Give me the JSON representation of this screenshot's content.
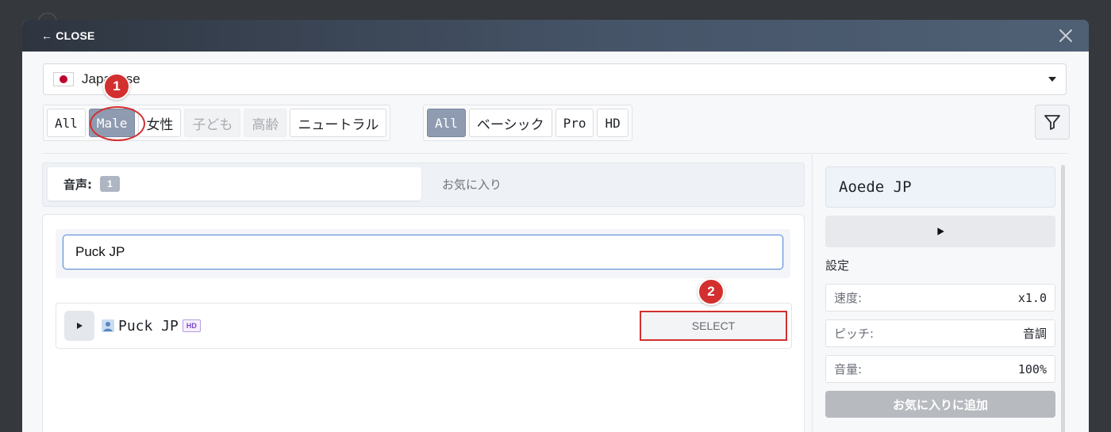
{
  "header": {
    "close_label": "← CLOSE"
  },
  "language": {
    "selected": "Japanese",
    "flag": "japan-flag"
  },
  "gender_filters": [
    {
      "label": "All",
      "state": "normal"
    },
    {
      "label": "Male",
      "state": "active"
    },
    {
      "label": "女性",
      "state": "normal"
    },
    {
      "label": "子ども",
      "state": "disabled"
    },
    {
      "label": "高齢",
      "state": "disabled"
    },
    {
      "label": "ニュートラル",
      "state": "normal"
    }
  ],
  "tier_filters": [
    {
      "label": "All",
      "state": "active"
    },
    {
      "label": "ベーシック",
      "state": "normal"
    },
    {
      "label": "Pro",
      "state": "normal"
    },
    {
      "label": "HD",
      "state": "normal"
    }
  ],
  "tabs": {
    "voices_label": "音声:",
    "voices_count": "1",
    "favorites_label": "お気に入り"
  },
  "search": {
    "value": "Puck JP"
  },
  "voices": [
    {
      "name": "Puck JP",
      "badge": "HD",
      "select_label": "SELECT"
    }
  ],
  "preview": {
    "voice_name": "Aoede JP",
    "settings_title": "設定",
    "speed_label": "速度:",
    "speed_value": "x1.0",
    "pitch_label": "ピッチ:",
    "pitch_value": "音調",
    "volume_label": "音量:",
    "volume_value": "100%",
    "favorite_button": "お気に入りに追加"
  },
  "annotations": {
    "step1": "1",
    "step2": "2"
  },
  "colors": {
    "accent_red": "#d32f2f",
    "active_chip": "#8e9bb0",
    "header_dark": "#2e3540"
  }
}
